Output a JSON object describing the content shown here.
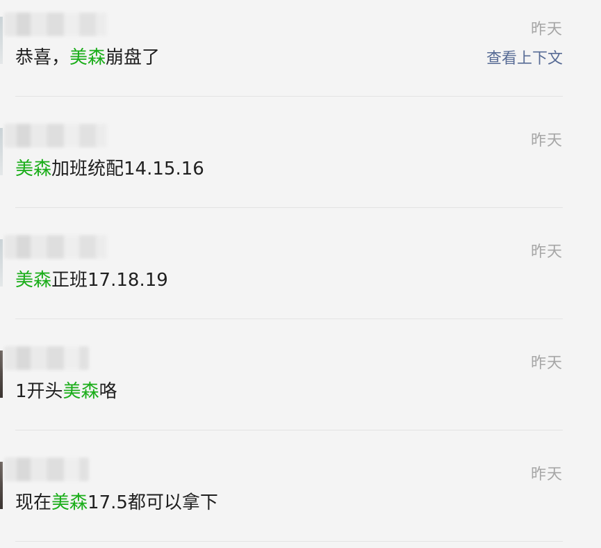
{
  "results": [
    {
      "time": "昨天",
      "segments": [
        {
          "text": "恭喜，",
          "hl": false
        },
        {
          "text": "美森",
          "hl": true
        },
        {
          "text": "崩盘了",
          "hl": false
        }
      ],
      "context_link": "查看上下文",
      "avatar_tone": "light"
    },
    {
      "time": "昨天",
      "segments": [
        {
          "text": "美森",
          "hl": true
        },
        {
          "text": "加班统配14.15.16",
          "hl": false
        }
      ],
      "avatar_tone": "light"
    },
    {
      "time": "昨天",
      "segments": [
        {
          "text": "美森",
          "hl": true
        },
        {
          "text": "正班17.18.19",
          "hl": false
        }
      ],
      "avatar_tone": "light"
    },
    {
      "time": "昨天",
      "segments": [
        {
          "text": "1开头",
          "hl": false
        },
        {
          "text": "美森",
          "hl": true
        },
        {
          "text": "咯",
          "hl": false
        }
      ],
      "avatar_tone": "dark"
    },
    {
      "time": "昨天",
      "segments": [
        {
          "text": "现在",
          "hl": false
        },
        {
          "text": "美森",
          "hl": true
        },
        {
          "text": "17.5都可以拿下",
          "hl": false
        }
      ],
      "avatar_tone": "dark"
    }
  ],
  "colors": {
    "highlight": "#1aad19",
    "link": "#576b95",
    "time": "#a6a6a6",
    "text": "#1f1f1f",
    "background": "#f4f4f4"
  }
}
